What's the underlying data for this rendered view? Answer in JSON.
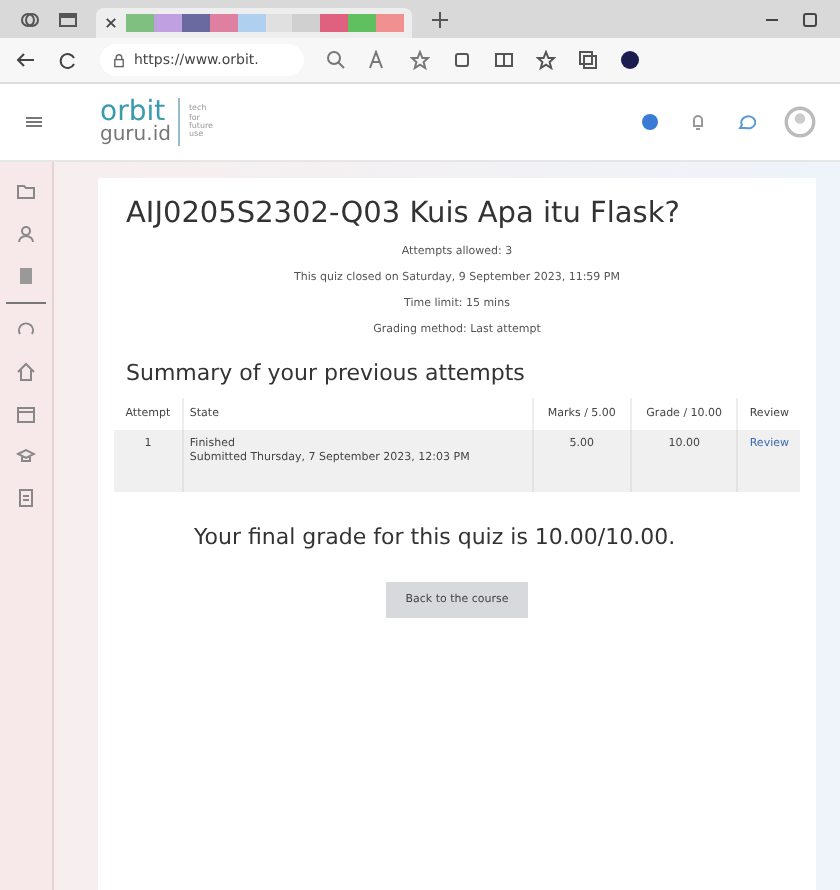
{
  "browser": {
    "address": "https://www.orbit."
  },
  "site": {
    "logo_top": "orbit",
    "logo_bottom": "guru.id",
    "tagline": [
      "tech",
      "for",
      "future",
      "use"
    ]
  },
  "quiz": {
    "title": "AIJ0205S2302-Q03 Kuis Apa itu Flask?",
    "info": [
      "Attempts allowed: 3",
      "This quiz closed on Saturday, 9 September 2023, 11:59 PM",
      "Time limit: 15 mins",
      "Grading method: Last attempt"
    ],
    "summary_heading": "Summary of your previous attempts",
    "table": {
      "columns": [
        "Attempt",
        "State",
        "Marks / 5.00",
        "Grade / 10.00",
        "Review"
      ],
      "rows": [
        {
          "attempt": "1",
          "state": "Finished",
          "submitted": "Submitted Thursday, 7 September 2023, 12:03 PM",
          "marks": "5.00",
          "grade": "10.00",
          "review": "Review"
        }
      ]
    },
    "final_grade": "Your final grade for this quiz is 10.00/10.00.",
    "back_button": "Back to the course"
  }
}
